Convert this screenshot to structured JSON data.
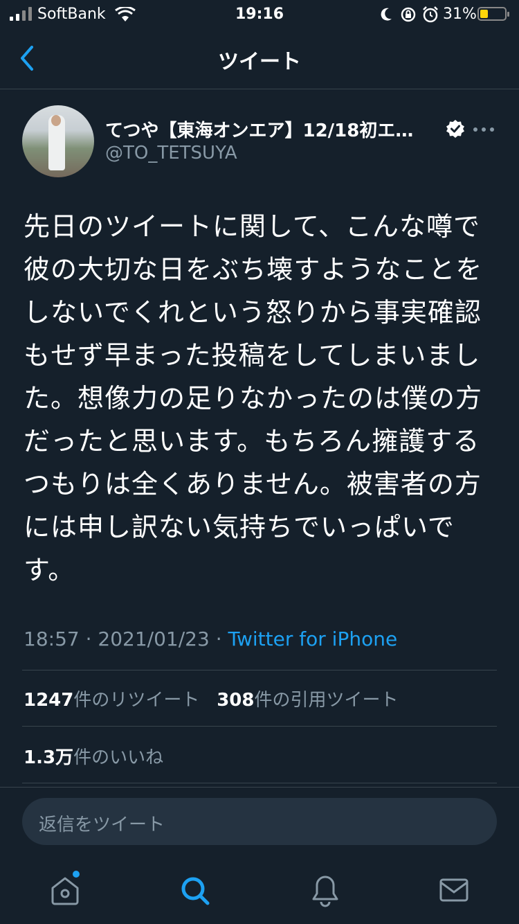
{
  "status_bar": {
    "carrier": "SoftBank",
    "time": "19:16",
    "battery_percent": "31%"
  },
  "nav": {
    "title": "ツイート"
  },
  "tweet": {
    "display_name": "てつや【東海オンエア】12/18初エ…",
    "handle": "@TO_TETSUYA",
    "text": "先日のツイートに関して、こんな噂で彼の大切な日をぶち壊すようなことをしないでくれという怒りから事実確認もせず早まった投稿をしてしまいました。想像力の足りなかったのは僕の方だったと思います。もちろん擁護するつもりは全くありません。被害者の方には申し訳ない気持ちでいっぱいです。",
    "time": "18:57",
    "separator": "·",
    "date": "2021/01/23",
    "source": "Twitter for iPhone",
    "retweets_count": "1247",
    "retweets_label": "件のリツイート",
    "quotes_count": "308",
    "quotes_label": "件の引用ツイート",
    "likes_count": "1.3万",
    "likes_label": "件のいいね"
  },
  "reply": {
    "placeholder": "返信をツイート"
  },
  "tab_bar": {
    "items": [
      "home-icon",
      "search-icon",
      "bell-icon",
      "mail-icon"
    ],
    "active": "search-icon"
  },
  "colors": {
    "background": "#15202b",
    "accent": "#1da1f2",
    "secondary_text": "#8899a6"
  }
}
